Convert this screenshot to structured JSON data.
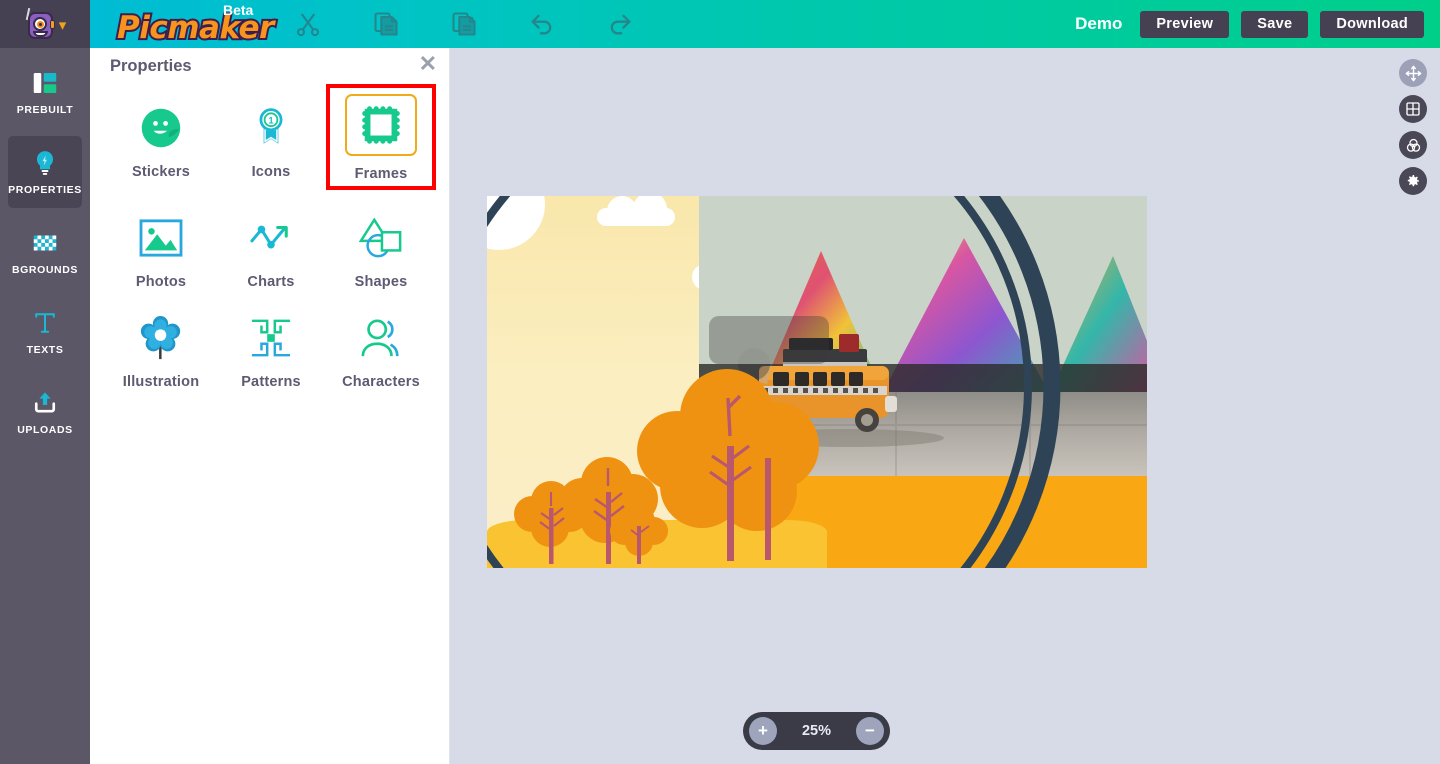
{
  "app": {
    "brand": "Picmaker",
    "badge": "Beta",
    "mascot_icon": "robot-mascot-icon",
    "brand_caret_icon": "chevron-down-icon"
  },
  "header": {
    "tools": [
      {
        "name": "cut-icon",
        "label": "Cut"
      },
      {
        "name": "copy-icon",
        "label": "Copy"
      },
      {
        "name": "paste-icon",
        "label": "Paste"
      },
      {
        "name": "undo-icon",
        "label": "Undo"
      },
      {
        "name": "redo-icon",
        "label": "Redo"
      }
    ],
    "project_name": "Demo",
    "buttons": [
      {
        "name": "preview-button",
        "label": "Preview"
      },
      {
        "name": "save-button",
        "label": "Save"
      },
      {
        "name": "download-button",
        "label": "Download"
      }
    ],
    "accent_left": "#00bcd4",
    "accent_right": "#00cf8a",
    "button_bg": "#454152"
  },
  "sidebar": {
    "items": [
      {
        "label": "PREBUILT",
        "icon": "layout-grid-icon",
        "active": false
      },
      {
        "label": "PROPERTIES",
        "icon": "lightbulb-icon",
        "active": true
      },
      {
        "label": "BGROUNDS",
        "icon": "checkerboard-icon",
        "active": false
      },
      {
        "label": "TEXTS",
        "icon": "text-t-icon",
        "active": false
      },
      {
        "label": "UPLOADS",
        "icon": "upload-tray-icon",
        "active": false
      }
    ],
    "bg": "#5b5767",
    "active_bg": "#494554"
  },
  "panel": {
    "title": "Properties",
    "close_icon": "close-icon",
    "close_label": "✕",
    "items": [
      {
        "label": "Stickers",
        "icon": "sticker-smiley-icon",
        "selected": false
      },
      {
        "label": "Icons",
        "icon": "award-ribbon-icon",
        "selected": false
      },
      {
        "label": "Frames",
        "icon": "stamp-frame-icon",
        "selected": true
      },
      {
        "label": "Photos",
        "icon": "photo-image-icon",
        "selected": false
      },
      {
        "label": "Charts",
        "icon": "line-chart-icon",
        "selected": false
      },
      {
        "label": "Shapes",
        "icon": "shapes-icon",
        "selected": false
      },
      {
        "label": "Illustration",
        "icon": "flower-icon",
        "selected": false
      },
      {
        "label": "Patterns",
        "icon": "pattern-blocks-icon",
        "selected": false
      },
      {
        "label": "Characters",
        "icon": "person-avatar-icon",
        "selected": false
      }
    ],
    "selection_outline": "#ff0000",
    "selection_inner_border": "#f0ab1a"
  },
  "canvas": {
    "background": "#d7dbe8",
    "artboard": {
      "description": "Travel poster design: autumn landscape illustration with sun, clouds, orange trees on the left, circular dark arc frame, photo of an orange vintage toy van on pavement with colorful graffiti mountains, and an orange band at the bottom",
      "sky_color": "#f9e7ab",
      "ground_color": "#f9c332",
      "tree_color": "#ef9212",
      "trunk_color": "#b9576c",
      "arc_color": "#2f4356",
      "band_color": "#f9a813",
      "photo_sky_color": "#c9d3c7"
    },
    "zoom": {
      "value": "25%",
      "zoom_in_label": "+",
      "zoom_out_label": "−",
      "zoom_in_icon": "plus-icon",
      "zoom_out_icon": "minus-icon"
    },
    "right_tools": [
      {
        "name": "move-tool-icon",
        "label": "Move",
        "active": true
      },
      {
        "name": "grid-tool-icon",
        "label": "Grid",
        "active": false
      },
      {
        "name": "color-tool-icon",
        "label": "Colors",
        "active": false
      },
      {
        "name": "settings-tool-icon",
        "label": "Settings",
        "active": false
      }
    ]
  }
}
